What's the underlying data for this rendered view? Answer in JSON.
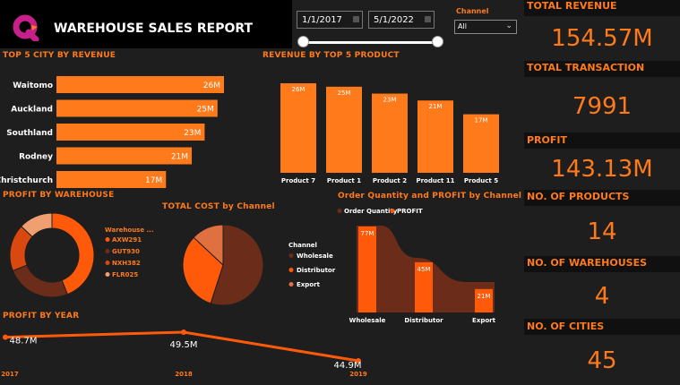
{
  "header": {
    "title": "WAREHOUSE SALES REPORT",
    "logo_icon": "q-logo-icon"
  },
  "filters": {
    "start_date": "1/1/2017",
    "end_date": "5/1/2022",
    "calendar_icon": "calendar-icon",
    "channel_label": "Channel",
    "channel_value": "All"
  },
  "colors": {
    "background": "#1e1e1e",
    "accent": "#ff7a1a",
    "orange_dark": "#e05a0a",
    "brown": "#6b2d1a",
    "peach": "#f0a070"
  },
  "kpis": [
    {
      "label": "TOTAL REVENUE",
      "value": "154.57M"
    },
    {
      "label": "TOTAL TRANSACTION",
      "value": "7991"
    },
    {
      "label": "PROFIT",
      "value": "143.13M"
    },
    {
      "label": "NO. OF PRODUCTS",
      "value": "14"
    },
    {
      "label": "NO. OF WAREHOUSES",
      "value": "4"
    },
    {
      "label": "NO. OF CITIES",
      "value": "45"
    }
  ],
  "chart_data": [
    {
      "type": "bar",
      "orientation": "horizontal",
      "title": "TOP 5 CITY BY REVENUE",
      "categories": [
        "Waitomo",
        "Auckland",
        "Southland",
        "Rodney",
        "Christchurch"
      ],
      "values": [
        26,
        25,
        23,
        21,
        17
      ],
      "data_labels": [
        "26M",
        "25M",
        "23M",
        "21M",
        "17M"
      ],
      "xlim": [
        0,
        26
      ]
    },
    {
      "type": "bar",
      "title": "REVENUE BY TOP 5 PRODUCT",
      "categories": [
        "Product 7",
        "Product 1",
        "Product 2",
        "Product 11",
        "Product 5"
      ],
      "values": [
        26,
        25,
        23,
        21,
        17
      ],
      "data_labels": [
        "26M",
        "25M",
        "23M",
        "21M",
        "17M"
      ],
      "ylim": [
        0,
        26
      ]
    },
    {
      "type": "pie",
      "donut": true,
      "title": "PROFIT BY WAREHOUSE",
      "legend_title": "Warehouse ...",
      "legend_position": "right",
      "series": [
        {
          "name": "AXW291",
          "value": 44,
          "color": "#ff5a0a"
        },
        {
          "name": "GUT930",
          "value": 25,
          "color": "#6b2d1a"
        },
        {
          "name": "NXH382",
          "value": 18,
          "color": "#d9480f"
        },
        {
          "name": "FLR025",
          "value": 13,
          "color": "#f0a070"
        }
      ]
    },
    {
      "type": "pie",
      "title": "TOTAL COST by Channel",
      "legend_title": "Channel",
      "legend_position": "right",
      "series": [
        {
          "name": "Wholesale",
          "value": 55,
          "color": "#6b2d1a"
        },
        {
          "name": "Distributor",
          "value": 32,
          "color": "#ff5a0a"
        },
        {
          "name": "Export",
          "value": 13,
          "color": "#e07040"
        }
      ]
    },
    {
      "type": "bar",
      "title": "Order Quantity and PROFIT by Channel",
      "legend_position": "top-left",
      "categories": [
        "Wholesale",
        "Distributor",
        "Export"
      ],
      "series": [
        {
          "name": "Order Quantity",
          "color": "#6b2d1a",
          "values": [
            null,
            null,
            null
          ]
        },
        {
          "name": "PROFIT",
          "color": "#ff5a0a",
          "values": [
            77,
            45,
            21
          ]
        }
      ],
      "data_labels": [
        "77M",
        "45M",
        "21M"
      ],
      "ylim": [
        0,
        77
      ]
    },
    {
      "type": "line",
      "title": "PROFIT BY YEAR",
      "x": [
        "2017",
        "2018",
        "2019"
      ],
      "values": [
        48.7,
        49.5,
        44.9
      ],
      "data_labels": [
        "48.7M",
        "49.5M",
        "44.9M"
      ],
      "ylim": [
        44.9,
        49.5
      ]
    }
  ]
}
